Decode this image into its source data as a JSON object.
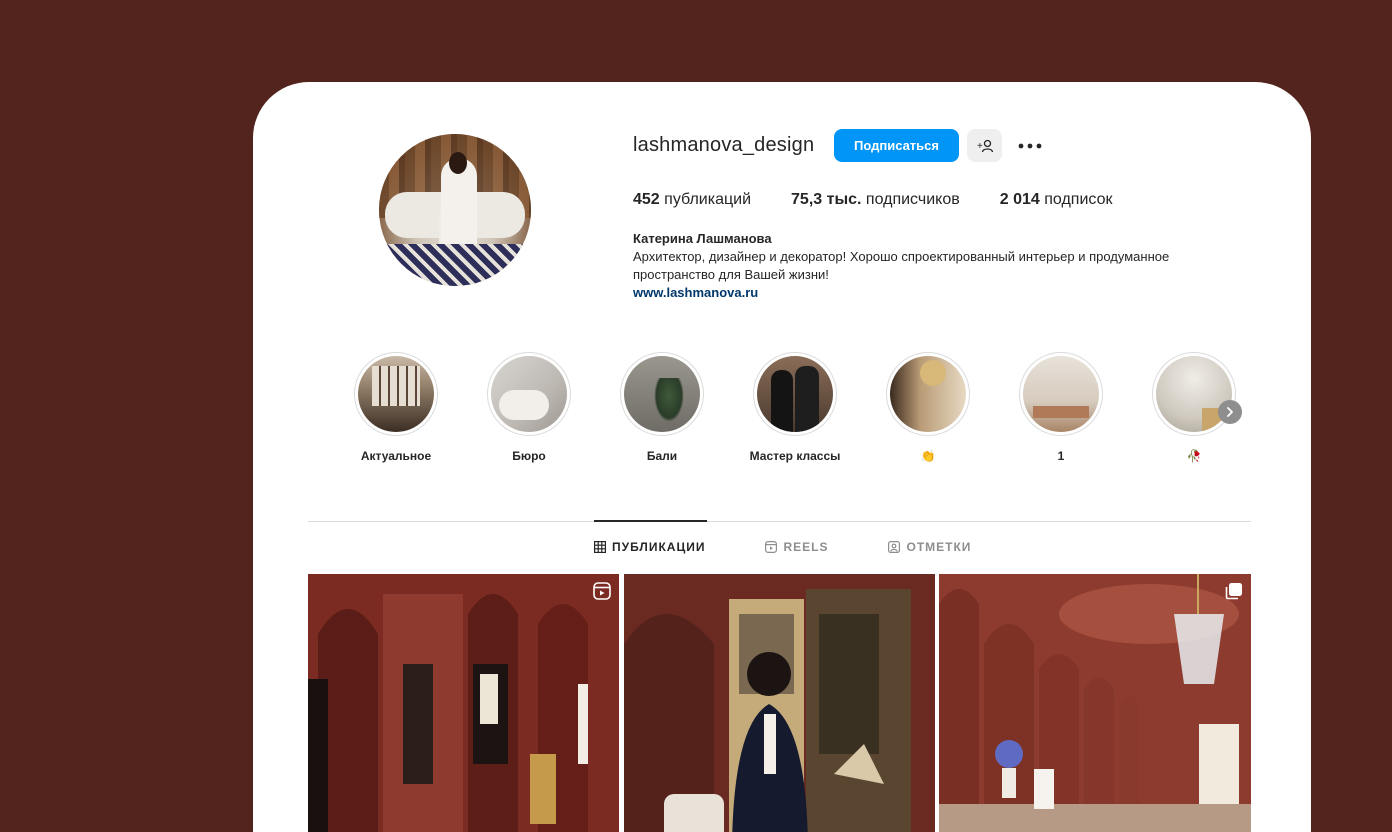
{
  "profile": {
    "username": "lashmanova_design",
    "follow_label": "Подписаться",
    "stats": {
      "posts_count": "452",
      "posts_label": "публикаций",
      "followers_count": "75,3 тыс.",
      "followers_label": "подписчиков",
      "following_count": "2 014",
      "following_label": "подписок"
    },
    "bio": {
      "name": "Катерина Лашманова",
      "text": "Архитектор, дизайнер и декоратор! Хорошо спроектированный интерьер и продуманное пространство для Вашей жизни!",
      "link": "www.lashmanova.ru"
    }
  },
  "highlights": [
    {
      "label": "Актуальное"
    },
    {
      "label": "Бюро"
    },
    {
      "label": "Бали"
    },
    {
      "label": "Мастер классы"
    },
    {
      "label": "👏"
    },
    {
      "label": "1"
    },
    {
      "label": "🥀"
    }
  ],
  "tabs": [
    {
      "label": "ПУБЛИКАЦИИ",
      "icon": "grid-icon",
      "active": true
    },
    {
      "label": "REELS",
      "icon": "reels-icon",
      "active": false
    },
    {
      "label": "ОТМЕТКИ",
      "icon": "tagged-icon",
      "active": false
    }
  ],
  "posts": [
    {
      "badge": "reel-icon"
    },
    {
      "badge": ""
    },
    {
      "badge": "carousel-icon"
    }
  ],
  "colors": {
    "background": "#52241d",
    "accent": "#0095f6",
    "link": "#00376b"
  }
}
